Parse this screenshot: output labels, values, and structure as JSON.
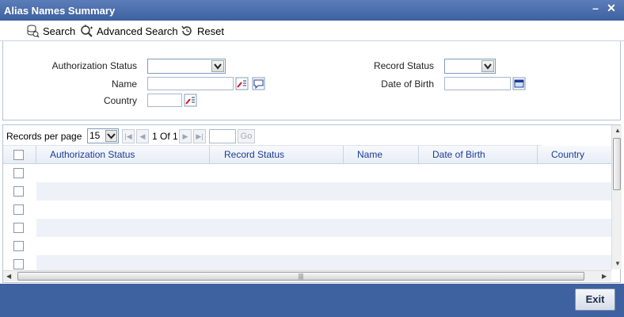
{
  "window": {
    "title": "Alias Names Summary"
  },
  "toolbar": {
    "search": "Search",
    "advanced_search": "Advanced Search",
    "reset": "Reset"
  },
  "form": {
    "authorization_status_label": "Authorization Status",
    "name_label": "Name",
    "country_label": "Country",
    "record_status_label": "Record Status",
    "date_of_birth_label": "Date of Birth"
  },
  "pager": {
    "records_per_page_label": "Records per page",
    "records_per_page_value": "15",
    "page_info": "1 Of 1",
    "go_label": "Go"
  },
  "table": {
    "columns": [
      "Authorization Status",
      "Record Status",
      "Name",
      "Date of Birth",
      "Country"
    ]
  },
  "footer": {
    "exit": "Exit"
  },
  "colors": {
    "title_bar": "#3e61a0",
    "header_text": "#1c3a96",
    "row_alt": "#eef2f8"
  }
}
